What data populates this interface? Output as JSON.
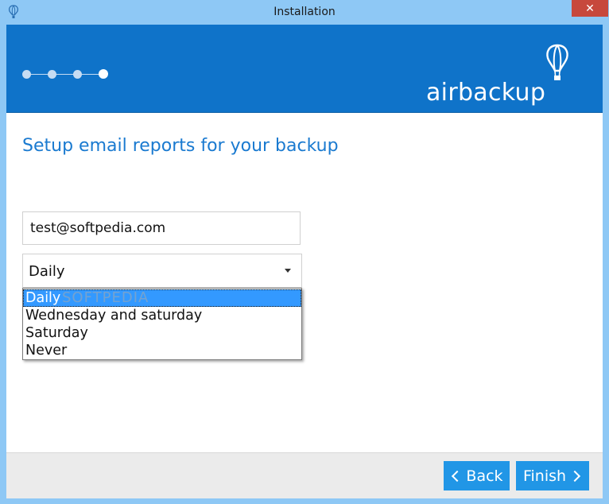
{
  "window": {
    "title": "Installation",
    "close_glyph": "✕"
  },
  "banner": {
    "brand": "airbackup",
    "steps_total": 4,
    "current_step": 4,
    "color": "#0f73c9"
  },
  "main": {
    "heading": "Setup email reports for your backup",
    "email_value": "test@softpedia.com",
    "frequency": {
      "selected": "Daily",
      "options": [
        "Daily",
        "Wednesday and saturday",
        "Saturday",
        "Never"
      ]
    }
  },
  "footer": {
    "back_label": "Back",
    "finish_label": "Finish"
  },
  "watermark": "SOFTPEDIA",
  "colors": {
    "accent": "#2196e6",
    "heading": "#1a7ad0",
    "selection": "#3399ff"
  }
}
